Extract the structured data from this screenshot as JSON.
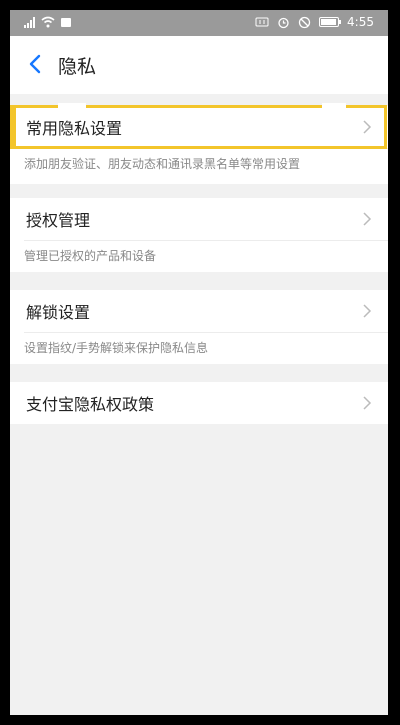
{
  "statusbar": {
    "time": "4:55",
    "battery_level": 0.95,
    "icons": [
      "signal-icon",
      "wifi-icon",
      "notification-icon",
      "hd-icon",
      "alarm-icon",
      "mute-icon",
      "battery-icon"
    ]
  },
  "nav": {
    "title": "隐私",
    "back_icon": "chevron-left-icon"
  },
  "items": [
    {
      "label": "常用隐私设置",
      "desc": "添加朋友验证、朋友动态和通讯录黑名单等常用设置"
    },
    {
      "label": "授权管理",
      "desc": "管理已授权的产品和设备"
    },
    {
      "label": "解锁设置",
      "desc": "设置指纹/手势解锁来保护隐私信息"
    },
    {
      "label": "支付宝隐私权政策"
    }
  ],
  "colors": {
    "accent": "#1677ff",
    "highlight": "#f3c52b",
    "background": "#f1f1f1"
  }
}
